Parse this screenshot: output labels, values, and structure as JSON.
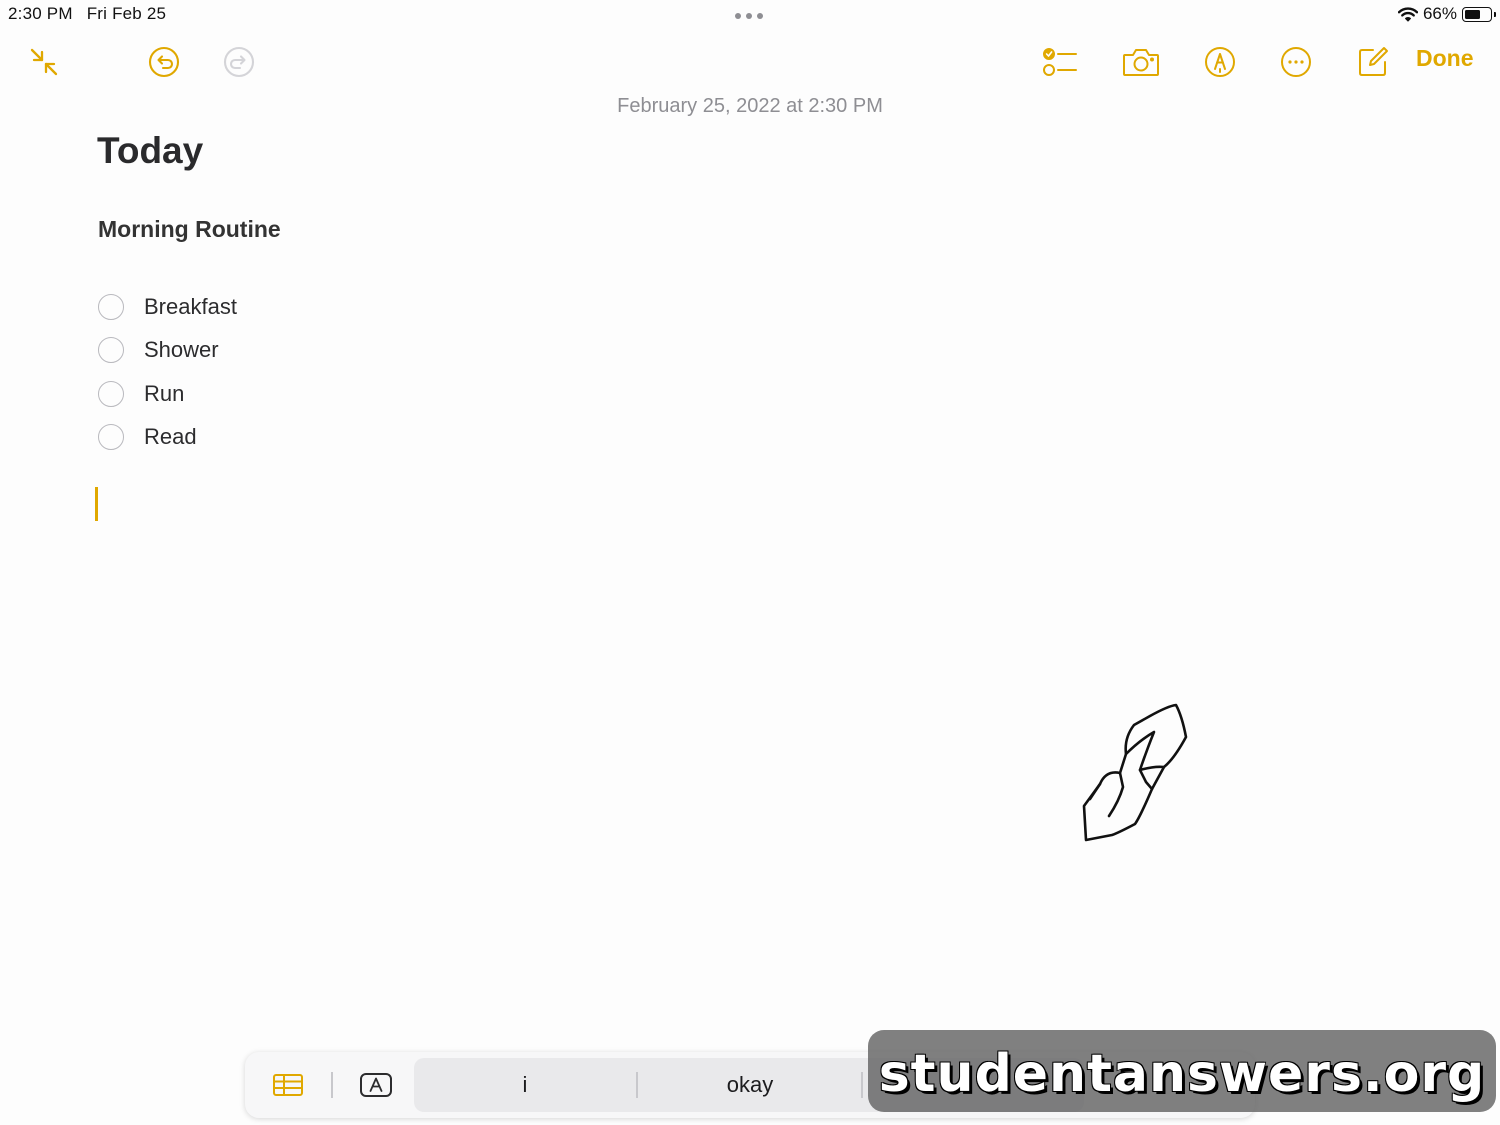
{
  "status_bar": {
    "time": "2:30 PM",
    "date": "Fri Feb 25",
    "battery_percent": "66%",
    "battery_level": 0.66,
    "icons": [
      "multitasking-dots-icon",
      "wifi-icon",
      "battery-icon"
    ]
  },
  "colors": {
    "accent": "#e0a800",
    "text": "#2a2a2c",
    "secondary_text": "#8e8e93"
  },
  "toolbar": {
    "icons": [
      "collapse-icon",
      "undo-icon",
      "redo-icon",
      "checklist-icon",
      "camera-icon",
      "markup-icon",
      "more-icon",
      "compose-icon"
    ],
    "done_label": "Done"
  },
  "note": {
    "timestamp": "February 25, 2022 at 2:30 PM",
    "title": "Today",
    "heading": "Morning Routine",
    "checklist": [
      {
        "text": "Breakfast",
        "checked": false
      },
      {
        "text": "Shower",
        "checked": false
      },
      {
        "text": "Run",
        "checked": false
      },
      {
        "text": "Read",
        "checked": false
      }
    ]
  },
  "shortcut_bar": {
    "icons": [
      "table-icon",
      "text-format-icon"
    ],
    "suggestions": [
      "i",
      "okay"
    ]
  },
  "watermark": "studentanswers.org"
}
